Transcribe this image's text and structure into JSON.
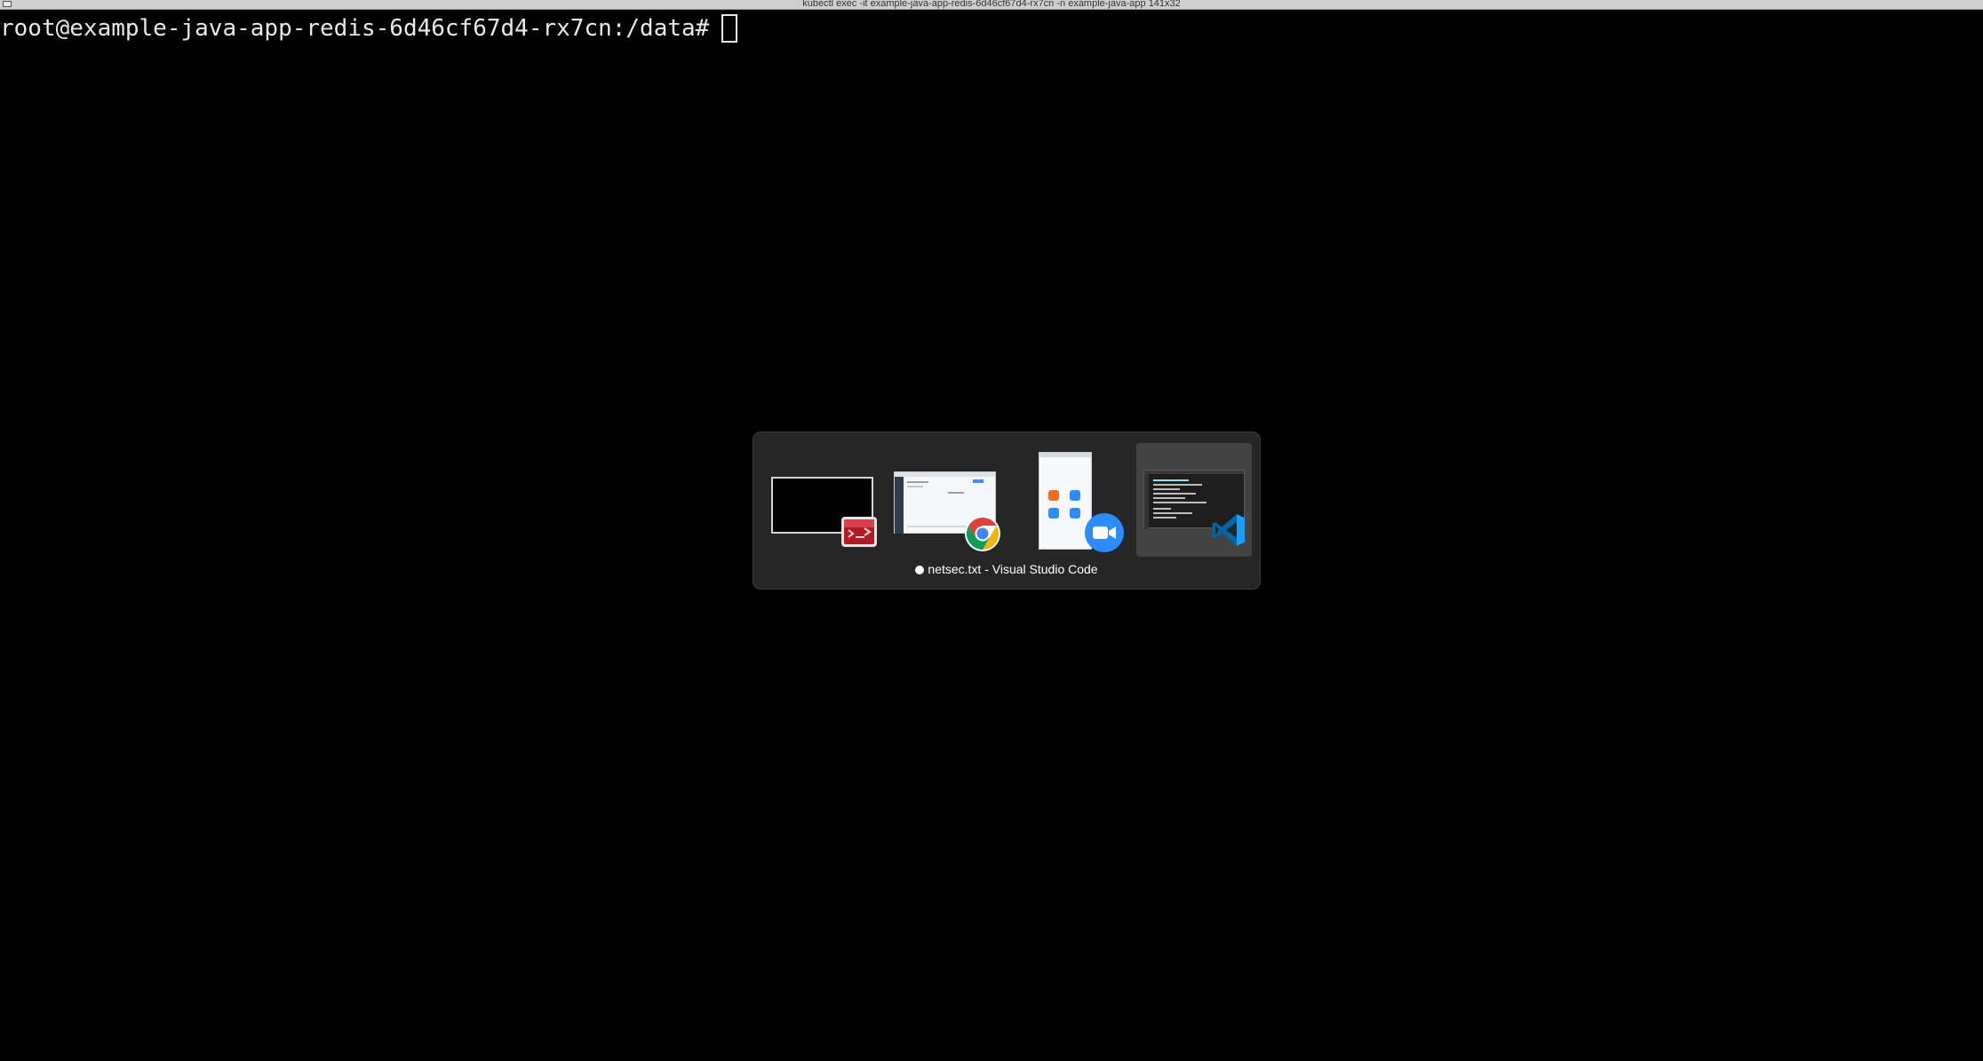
{
  "window": {
    "title": "kubectl exec -it example-java-app-redis-6d46cf67d4-rx7cn -n example-java-app  141x32"
  },
  "terminal": {
    "prompt": "root@example-java-app-redis-6d46cf67d4-rx7cn:/data#"
  },
  "app_switcher": {
    "selected_label": "netsec.txt - Visual Studio Code",
    "modified_indicator": "●",
    "apps": [
      {
        "icon": "terminal-icon",
        "accent": "#c0262e"
      },
      {
        "icon": "chrome-icon",
        "accent": "#4285f4"
      },
      {
        "icon": "zoom-icon",
        "accent": "#2d8cff"
      },
      {
        "icon": "vscode-icon",
        "accent": "#23a9f2",
        "selected": true
      }
    ]
  }
}
